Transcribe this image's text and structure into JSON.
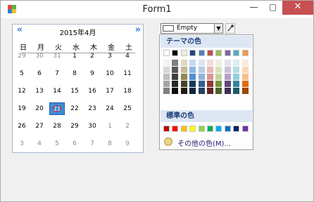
{
  "window": {
    "title": "Form1",
    "minimize": "—",
    "maximize": "▢",
    "close": "✕"
  },
  "calendar": {
    "month_label": "2015年4月",
    "prev": "«",
    "next": "»",
    "weekdays": [
      "日",
      "月",
      "火",
      "水",
      "木",
      "金",
      "土"
    ],
    "weeks": [
      [
        "29",
        "30",
        "31",
        "1",
        "2",
        "3",
        "4"
      ],
      [
        "5",
        "6",
        "7",
        "8",
        "9",
        "10",
        "11"
      ],
      [
        "12",
        "13",
        "14",
        "15",
        "16",
        "17",
        "18"
      ],
      [
        "19",
        "20",
        "21",
        "22",
        "23",
        "24",
        "25"
      ],
      [
        "26",
        "27",
        "28",
        "29",
        "30",
        "1",
        "2"
      ],
      [
        "3",
        "4",
        "5",
        "6",
        "7",
        "8",
        "9"
      ]
    ],
    "selected_day": "21",
    "today_day": "21"
  },
  "color_combo": {
    "value": "Empty",
    "dropdown_arrow": "▼"
  },
  "palette": {
    "theme_header": "テーマの色",
    "standard_header": "標準の色",
    "more_colors": "その他の色(M)...",
    "theme_top": [
      "#ffffff",
      "#000000",
      "#eeece1",
      "#1f497d",
      "#4f81bd",
      "#c0504d",
      "#9bbb59",
      "#8064a2",
      "#4bacc6",
      "#f79646"
    ],
    "theme_shades": [
      [
        "#f2f2f2",
        "#7f7f7f",
        "#ddd9c3",
        "#c6d9f0",
        "#dbe5f1",
        "#f2dcdb",
        "#ebf1dd",
        "#e5e0ec",
        "#dbeef3",
        "#fdeada"
      ],
      [
        "#d8d8d8",
        "#595959",
        "#c4bd97",
        "#8db3e2",
        "#b8cce4",
        "#e5b9b7",
        "#d7e3bc",
        "#ccc1d9",
        "#b7dde8",
        "#fbd5b5"
      ],
      [
        "#bfbfbf",
        "#3f3f3f",
        "#938953",
        "#548dd4",
        "#95b3d7",
        "#d99694",
        "#c3d69b",
        "#b2a2c7",
        "#92cddc",
        "#fac08f"
      ],
      [
        "#a5a5a5",
        "#262626",
        "#494429",
        "#17365d",
        "#366092",
        "#953734",
        "#76923c",
        "#5f497a",
        "#31859b",
        "#e36c09"
      ],
      [
        "#7f7f7f",
        "#0c0c0c",
        "#1d1b10",
        "#0f243e",
        "#244061",
        "#632423",
        "#4f6128",
        "#3f3151",
        "#205867",
        "#974806"
      ]
    ],
    "standard": [
      "#c00000",
      "#ff0000",
      "#ffc000",
      "#ffff00",
      "#92d050",
      "#00b050",
      "#00b0f0",
      "#0070c0",
      "#002060",
      "#7030a0"
    ]
  }
}
